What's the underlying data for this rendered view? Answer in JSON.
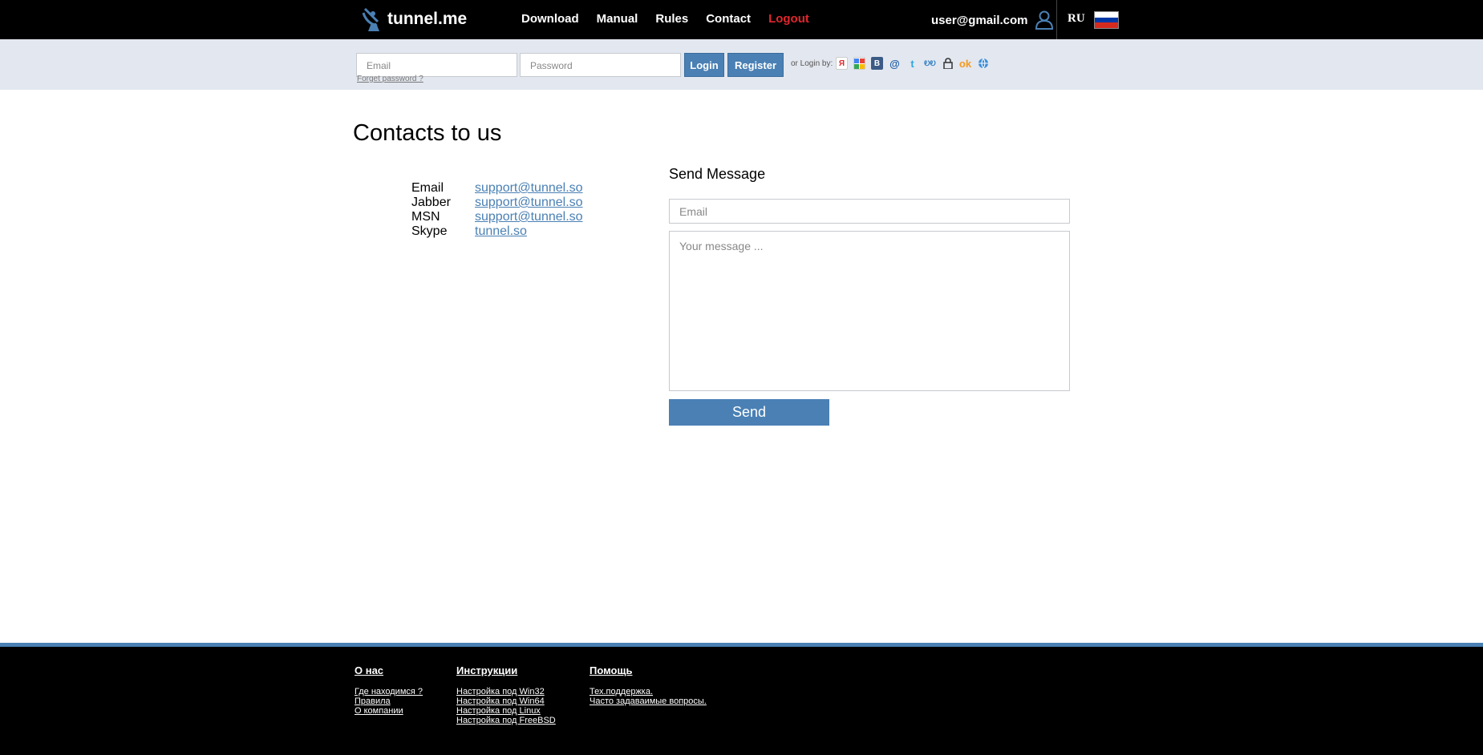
{
  "header": {
    "logo_text": "tunnel.me",
    "nav": [
      "Download",
      "Manual",
      "Rules",
      "Contact",
      "Logout"
    ],
    "user_email": "user@gmail.com",
    "lang": "RU"
  },
  "login": {
    "email_placeholder": "Email",
    "password_placeholder": "Password",
    "login_label": "Login",
    "register_label": "Register",
    "or_login_by": "or Login by:",
    "forget_password": "Forget password ?",
    "social_icons": [
      "yandex-icon",
      "google-icon",
      "vkontakte-icon",
      "mailru-icon",
      "twitter-icon",
      "livejournal-icon",
      "lock-icon",
      "odnoklassniki-icon",
      "openid-icon"
    ]
  },
  "main": {
    "title": "Contacts to us",
    "contacts": [
      {
        "label": "Email",
        "value": "support@tunnel.so"
      },
      {
        "label": "Jabber",
        "value": "support@tunnel.so"
      },
      {
        "label": "MSN",
        "value": "support@tunnel.so"
      },
      {
        "label": "Skype",
        "value": "tunnel.so"
      }
    ],
    "send_message": {
      "title": "Send Message",
      "email_placeholder": "Email",
      "message_placeholder": "Your message ...",
      "send_label": "Send"
    }
  },
  "footer": {
    "columns": [
      {
        "heading": "О нас",
        "links": [
          "Где находимся ?",
          "Правила",
          "О компании"
        ]
      },
      {
        "heading": "Инструкции",
        "links": [
          "Настройка под Win32",
          "Настройка под Win64",
          "Настройка под Linux",
          "Настройка под FreeBSD"
        ]
      },
      {
        "heading": "Помощь",
        "links": [
          "Тех.поддержка.",
          "Часто задаваимые вопросы."
        ]
      }
    ]
  },
  "colors": {
    "accent": "#4a80b4",
    "logout": "#e0262c",
    "login_strip": "#e3e7ef"
  }
}
